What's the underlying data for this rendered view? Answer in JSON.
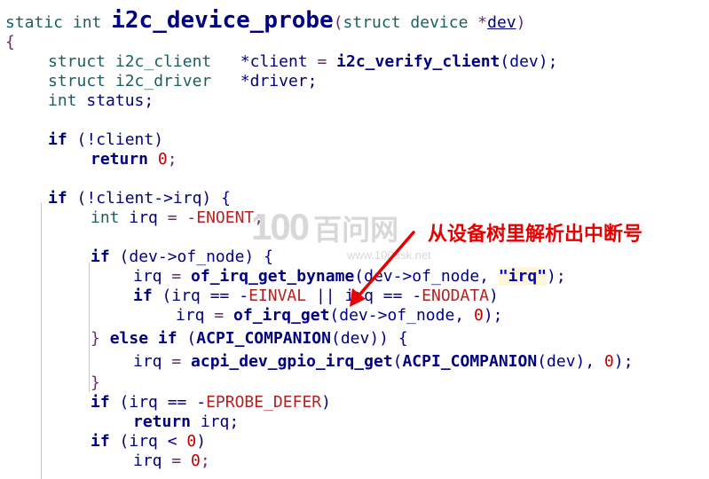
{
  "code": {
    "l1": {
      "static": "static",
      "int": "int",
      "name": "i2c_device_probe",
      "open": "(",
      "struct": "struct",
      "device": "device",
      "star": "*",
      "dev": "dev",
      "close": ")"
    },
    "l2": {
      "brace": "{"
    },
    "l3": {
      "struct": "struct",
      "type": "i2c_client",
      "var": "*client",
      "eq": "=",
      "fn": "i2c_verify_client",
      "args": "(dev);"
    },
    "l4": {
      "struct": "struct",
      "type": "i2c_driver",
      "var": "*driver;"
    },
    "l5": {
      "int": "int",
      "var": "status;"
    },
    "l6": {
      "if": "if",
      "cond": "(!client)"
    },
    "l7": {
      "return": "return",
      "val": "0",
      "semi": ";"
    },
    "l8": {
      "if": "if",
      "cond": "(!client->irq) {"
    },
    "l9": {
      "int": "int",
      "var": "irq",
      "eq": "= -",
      "macro": "ENOENT",
      "semi": ";"
    },
    "l10": {
      "if": "if",
      "cond": "(dev->of_node) {"
    },
    "l11": {
      "lhs": "irq",
      "eq": "=",
      "fn": "of_irq_get_byname",
      "args": "(dev->of_node, ",
      "str": "\"irq\"",
      "end": ");"
    },
    "l12": {
      "if": "if",
      "p1": "(irq == -",
      "m1": "EINVAL",
      "p2": " || irq == -",
      "m2": "ENODATA",
      "p3": ")"
    },
    "l13": {
      "lhs": "irq",
      "eq": "=",
      "fn": "of_irq_get",
      "args": "(dev->of_node, ",
      "num": "0",
      "end": ");"
    },
    "l14": {
      "rb": "}",
      "else": "else",
      "if": "if",
      "p1": "(",
      "fn": "ACPI_COMPANION",
      "args": "(dev)) {"
    },
    "l15": {
      "lhs": "irq",
      "eq": "=",
      "fn": "acpi_dev_gpio_irq_get",
      "p1": "(",
      "fn2": "ACPI_COMPANION",
      "args": "(dev), ",
      "num": "0",
      "end": ");"
    },
    "l16": {
      "rb": "}"
    },
    "l17": {
      "if": "if",
      "p1": "(irq == -",
      "macro": "EPROBE_DEFER",
      "p2": ")"
    },
    "l18": {
      "return": "return",
      "var": "irq;"
    },
    "l19": {
      "if": "if",
      "p1": "(irq < ",
      "num": "0",
      "p2": ")"
    },
    "l20": {
      "lhs": "irq",
      "eq": "=",
      "num": "0",
      "semi": ";"
    }
  },
  "watermark": {
    "logo": "100",
    "name": "百问网",
    "url": "www.100ask.net"
  },
  "annotation": {
    "text": "从设备树里解析出中断号",
    "color": "#e60000"
  }
}
